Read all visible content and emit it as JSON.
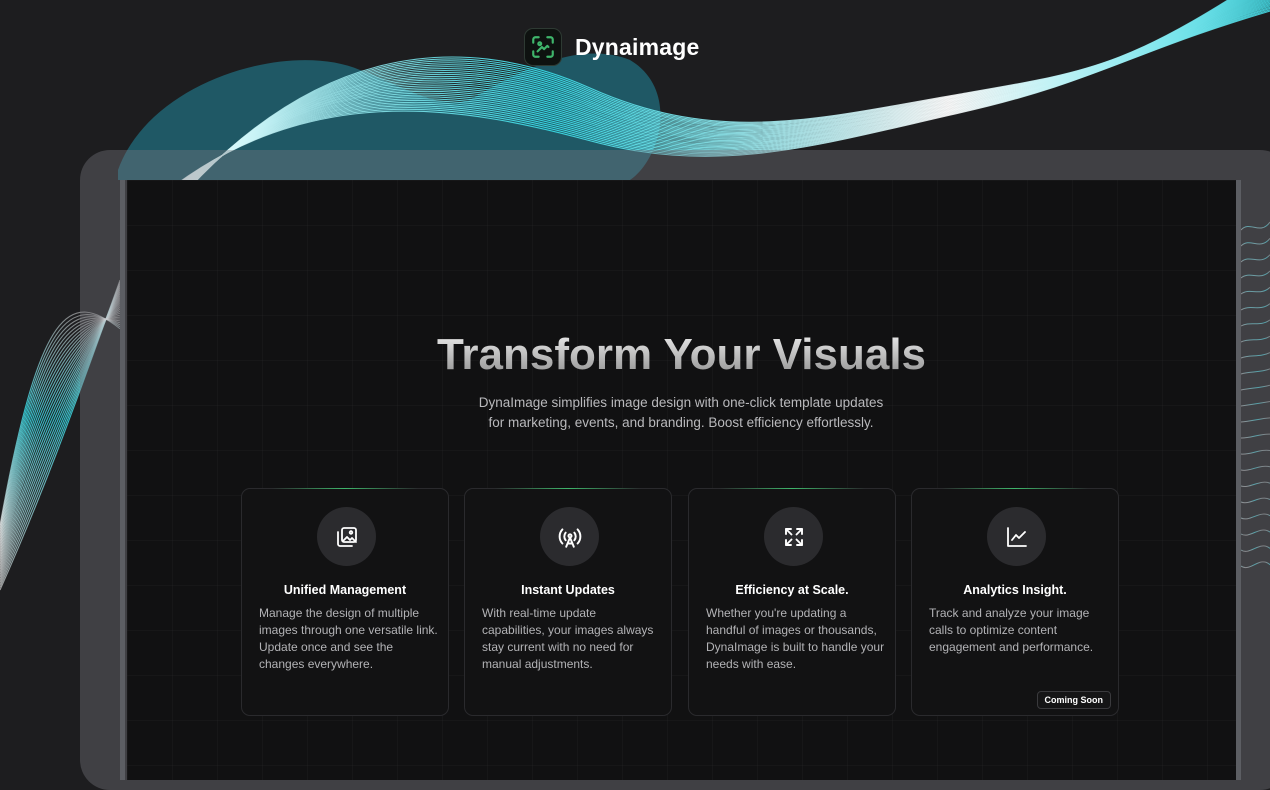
{
  "brand": {
    "name": "Dynaimage",
    "accent_color": "#3fb56b",
    "logo_icon": "scan-image-icon"
  },
  "hero": {
    "title": "Transform Your Visuals",
    "subtitle": "DynaImage simplifies image design with one-click template updates for marketing, events, and branding. Boost efficiency effortlessly."
  },
  "features": [
    {
      "icon": "image-gallery-icon",
      "title": "Unified Management",
      "description": "Manage the design of multiple images through one versatile link. Update once and see the changes everywhere."
    },
    {
      "icon": "broadcast-antenna-icon",
      "title": "Instant Updates",
      "description": "With real-time update capabilities, your images always stay current with no need for manual adjustments."
    },
    {
      "icon": "expand-arrows-icon",
      "title": "Efficiency at Scale.",
      "description": "Whether you're updating a handful of images or thousands, DynaImage is built to handle your needs with ease."
    },
    {
      "icon": "line-chart-icon",
      "title": "Analytics Insight.",
      "description": "Track and analyze your image calls to optimize content engagement and performance.",
      "badge": "Coming Soon"
    }
  ],
  "colors": {
    "background": "#1d1d1f",
    "wave_cyan": "#3ad6e0",
    "blob_teal": "#205a66"
  }
}
